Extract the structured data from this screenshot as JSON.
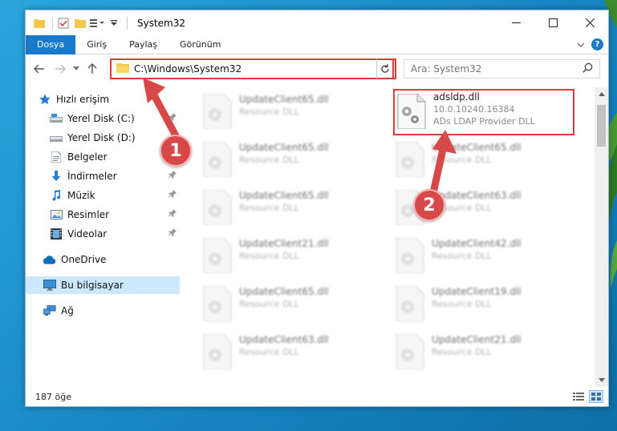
{
  "window": {
    "title": "System32"
  },
  "ribbon": {
    "tabs": [
      {
        "label": "Dosya",
        "active": true
      },
      {
        "label": "Giriş",
        "active": false
      },
      {
        "label": "Paylaş",
        "active": false
      },
      {
        "label": "Görünüm",
        "active": false
      }
    ],
    "help_label": "?"
  },
  "address_bar": {
    "path": "C:\\Windows\\System32"
  },
  "search": {
    "placeholder": "Ara: System32"
  },
  "sidebar": {
    "quick_access": "Hızlı erişim",
    "items": [
      {
        "label": "Yerel Disk (C:)",
        "icon": "drive-icon",
        "pinned": true
      },
      {
        "label": "Yerel Disk (D:)",
        "icon": "drive-icon",
        "pinned": false
      },
      {
        "label": "Belgeler",
        "icon": "documents-icon",
        "pinned": true
      },
      {
        "label": "İndirmeler",
        "icon": "download-icon",
        "pinned": true
      },
      {
        "label": "Müzik",
        "icon": "music-icon",
        "pinned": true
      },
      {
        "label": "Resimler",
        "icon": "pictures-icon",
        "pinned": true
      },
      {
        "label": "Videolar",
        "icon": "video-icon",
        "pinned": true
      }
    ],
    "onedrive": "OneDrive",
    "this_pc": "Bu bilgisayar",
    "network": "Ağ"
  },
  "files": {
    "highlighted": {
      "name": "adsldp.dll",
      "version": "10.0.10240.16384",
      "type": "ADs LDAP Provider DLL"
    },
    "left_column": [
      {
        "name": "UpdateClient65.dll",
        "type": "Resource DLL"
      },
      {
        "name": "UpdateClient65.dll",
        "type": "Resource DLL"
      },
      {
        "name": "UpdateClient65.dll",
        "type": "Resource DLL"
      },
      {
        "name": "UpdateClient21.dll",
        "type": "Resource DLL"
      },
      {
        "name": "UpdateClient65.dll",
        "type": "Resource DLL"
      },
      {
        "name": "UpdateClient63.dll",
        "type": "Resource DLL"
      }
    ],
    "right_column": [
      {
        "name": "UpdateClient65.dll",
        "type": "Resource DLL"
      },
      {
        "name": "UpdateClient63.dll",
        "type": "Resource DLL"
      },
      {
        "name": "UpdateClient42.dll",
        "type": "Resource DLL"
      },
      {
        "name": "UpdateClient19.dll",
        "type": "Resource DLL"
      },
      {
        "name": "UpdateClient21.dll",
        "type": "Resource DLL"
      }
    ]
  },
  "status": {
    "item_count": "187 öğe"
  },
  "annotations": {
    "step1": "1",
    "step2": "2",
    "accent_color": "#d74848"
  },
  "colors": {
    "selection": "#cce8ff",
    "ribbon_active": "#1979ca",
    "highlight_border": "#e03a3a"
  }
}
